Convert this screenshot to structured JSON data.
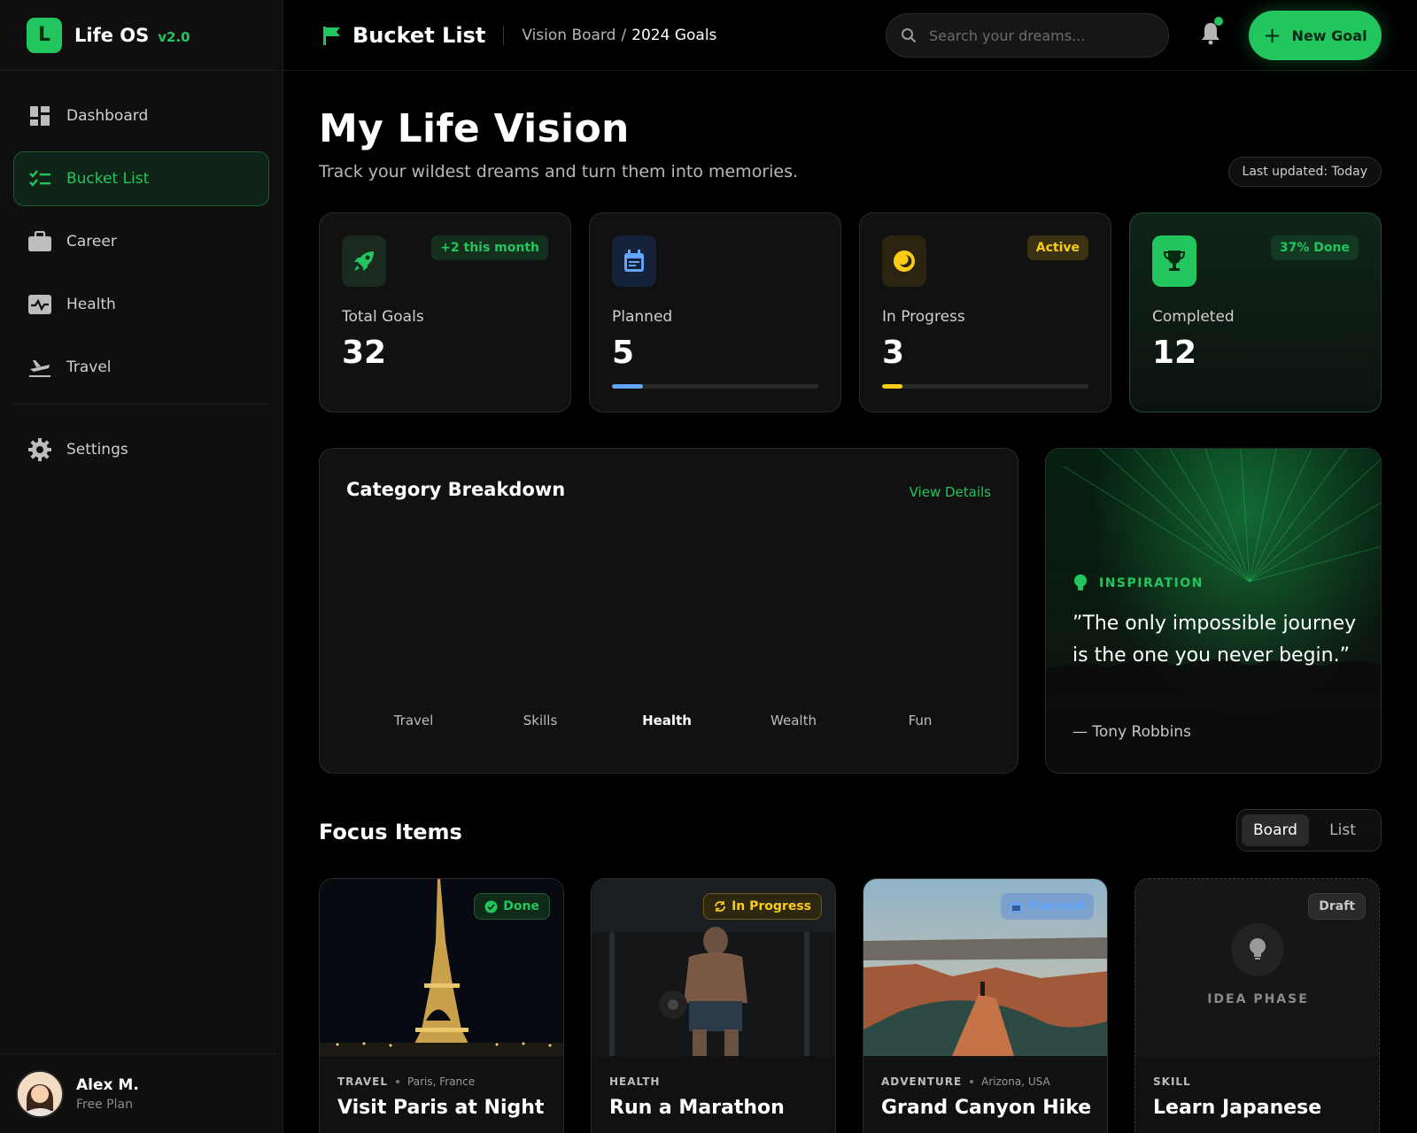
{
  "brand": {
    "logo_letter": "L",
    "name": "Life OS",
    "version": "v2.0"
  },
  "sidebar": {
    "items": [
      {
        "label": "Dashboard",
        "icon": "grid-icon"
      },
      {
        "label": "Bucket List",
        "icon": "checklist-icon",
        "active": true
      },
      {
        "label": "Career",
        "icon": "briefcase-icon"
      },
      {
        "label": "Health",
        "icon": "heart-pulse-icon"
      },
      {
        "label": "Travel",
        "icon": "plane-icon"
      }
    ],
    "settings": {
      "label": "Settings",
      "icon": "gear-icon"
    }
  },
  "user": {
    "name": "Alex M.",
    "plan": "Free Plan"
  },
  "header": {
    "page_name": "Bucket List",
    "breadcrumb": [
      "Vision Board",
      "2024 Goals"
    ],
    "search_placeholder": "Search your dreams...",
    "new_goal_label": "New Goal",
    "accent": "#22c55e"
  },
  "hero": {
    "title": "My Life Vision",
    "subtitle": "Track your wildest dreams and turn them into memories.",
    "updated": "Last updated: Today"
  },
  "stats": [
    {
      "label": "Total Goals",
      "value": "32",
      "badge": "+2 this month",
      "icon": "rocket-icon",
      "color": "#22c55e"
    },
    {
      "label": "Planned",
      "value": "5",
      "icon": "calendar-icon",
      "color": "#60a5fa",
      "progress": 0.15
    },
    {
      "label": "In Progress",
      "value": "3",
      "badge": "Active",
      "icon": "moon-icon",
      "color": "#facc15",
      "progress": 0.1
    },
    {
      "label": "Completed",
      "value": "12",
      "badge": "37% Done",
      "icon": "trophy-icon",
      "color": "#22c55e"
    }
  ],
  "category": {
    "title": "Category Breakdown",
    "link": "View Details",
    "categories": [
      "Travel",
      "Skills",
      "Health",
      "Wealth",
      "Fun"
    ],
    "selected": "Health"
  },
  "inspiration": {
    "tag": "INSPIRATION",
    "quote": "”The only impossible journey is the one you never begin.”",
    "author": "— Tony Robbins"
  },
  "focus": {
    "title": "Focus Items",
    "views": [
      "Board",
      "List"
    ],
    "selected_view": "Board",
    "items": [
      {
        "badge": "Done",
        "category": "TRAVEL",
        "location": "Paris, France",
        "title": "Visit Paris at Night"
      },
      {
        "badge": "In Progress",
        "category": "HEALTH",
        "location": "",
        "title": "Run a Marathon"
      },
      {
        "badge": "Planned",
        "category": "ADVENTURE",
        "location": "Arizona, USA",
        "title": "Grand Canyon Hike"
      },
      {
        "badge": "Draft",
        "category": "SKILL",
        "location": "",
        "title": "Learn Japanese",
        "placeholder": "IDEA PHASE"
      }
    ]
  }
}
